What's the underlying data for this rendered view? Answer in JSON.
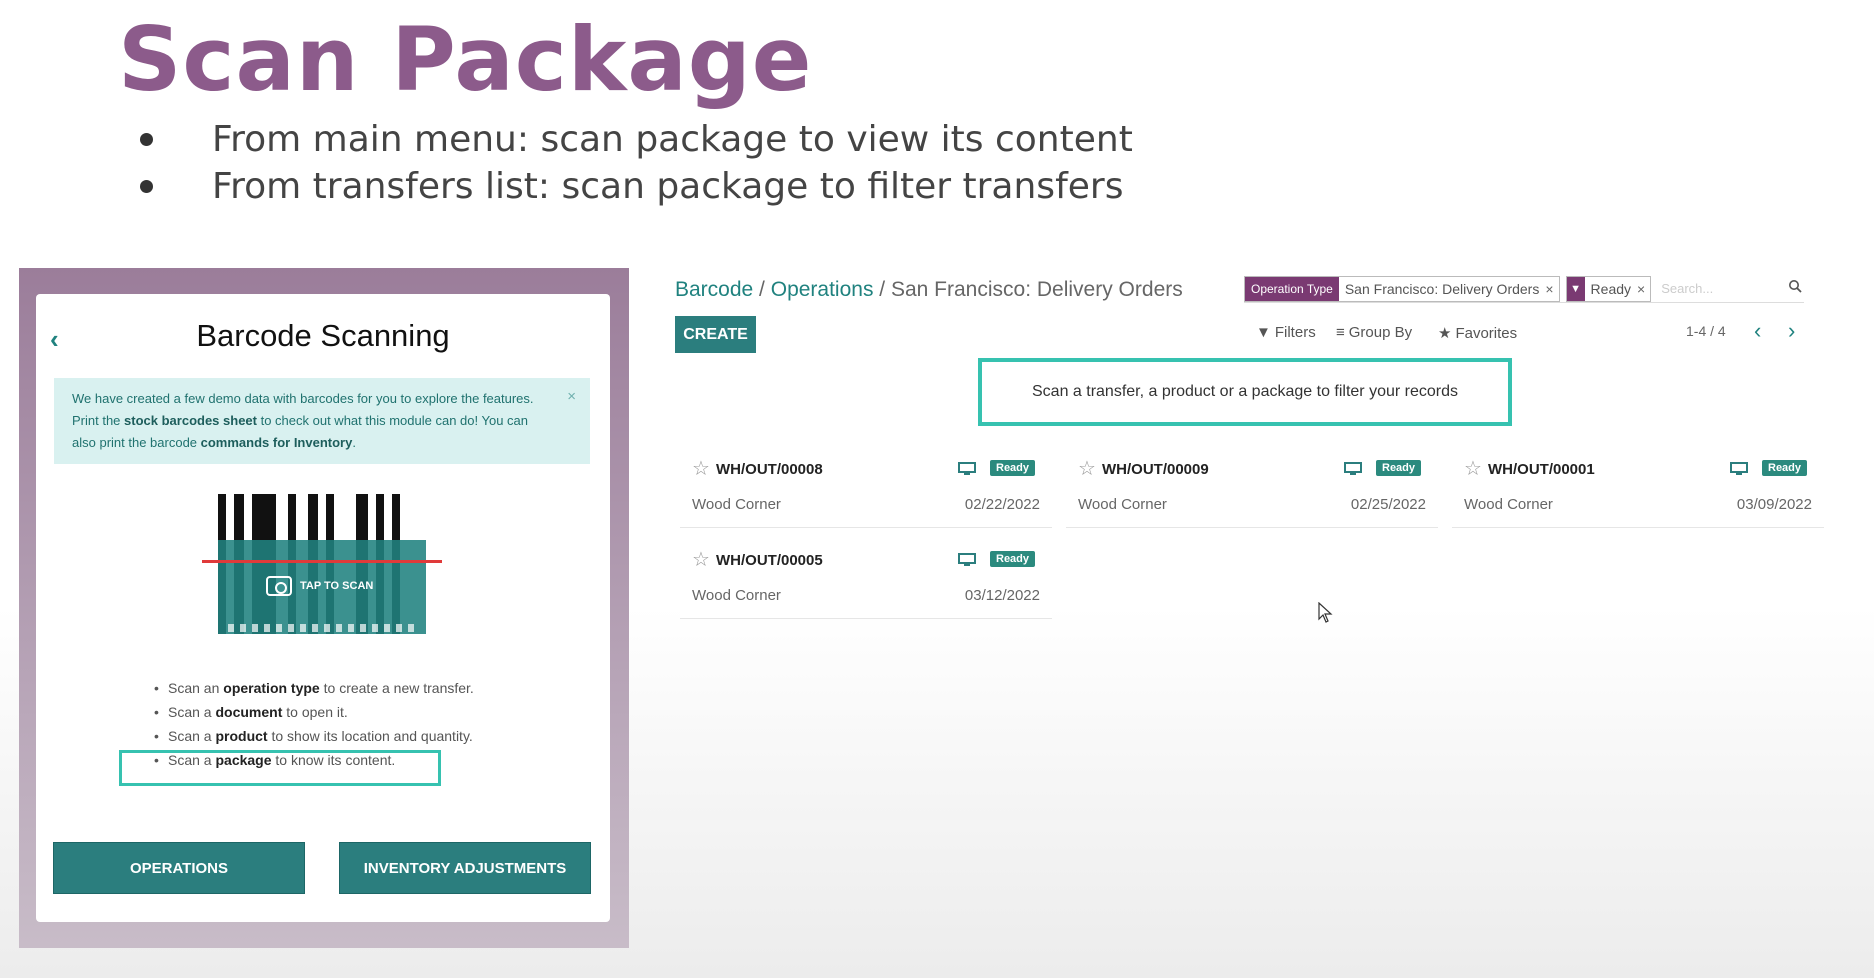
{
  "slide": {
    "title": "Scan Package",
    "bullets": [
      "From main menu: scan package to view its content",
      "From transfers list: scan package to filter transfers"
    ]
  },
  "phone": {
    "back_icon": "chevron-left-icon",
    "title": "Barcode Scanning",
    "info": {
      "text_1": "We have created a few demo data with barcodes for you to explore the features. Print the ",
      "link_1": "stock barcodes sheet",
      "text_2": " to check out what this module can do! You can also print the barcode ",
      "link_2": "commands for Inventory",
      "text_3": ".",
      "close": "×"
    },
    "tap_to_scan": "TAP TO SCAN",
    "instructions": [
      {
        "pre": "Scan an ",
        "bold": "operation type",
        "post": " to create a new transfer."
      },
      {
        "pre": "Scan a ",
        "bold": "document",
        "post": " to open it."
      },
      {
        "pre": "Scan a ",
        "bold": "product",
        "post": " to show its location and quantity."
      },
      {
        "pre": "Scan a ",
        "bold": "package",
        "post": " to know its content."
      }
    ],
    "buttons": {
      "operations": "OPERATIONS",
      "inventory_adjustments": "INVENTORY ADJUSTMENTS"
    }
  },
  "odoo": {
    "breadcrumb": {
      "barcode": "Barcode",
      "sep": " / ",
      "operations": "Operations",
      "current": "San Francisco: Delivery Orders"
    },
    "search": {
      "facet1_label": "Operation Type",
      "facet1_value": "San Francisco: Delivery Orders",
      "facet2_value": "Ready",
      "remove": "×",
      "placeholder": "Search..."
    },
    "create": "CREATE",
    "filters": "Filters",
    "group_by": "Group By",
    "favorites": "Favorites",
    "pager": "1-4 / 4",
    "scan_banner": "Scan a transfer, a product or a package to filter your records",
    "cards": [
      {
        "ref": "WH/OUT/00008",
        "partner": "Wood Corner",
        "date": "02/22/2022",
        "status": "Ready"
      },
      {
        "ref": "WH/OUT/00009",
        "partner": "Wood Corner",
        "date": "02/25/2022",
        "status": "Ready"
      },
      {
        "ref": "WH/OUT/00001",
        "partner": "Wood Corner",
        "date": "03/09/2022",
        "status": "Ready"
      },
      {
        "ref": "WH/OUT/00005",
        "partner": "Wood Corner",
        "date": "03/12/2022",
        "status": "Ready"
      }
    ]
  },
  "colors": {
    "title_purple": "#8c5b8b",
    "odoo_teal": "#2b7e7e",
    "highlight": "#36c2b0",
    "facet_purple": "#7a3a72"
  }
}
